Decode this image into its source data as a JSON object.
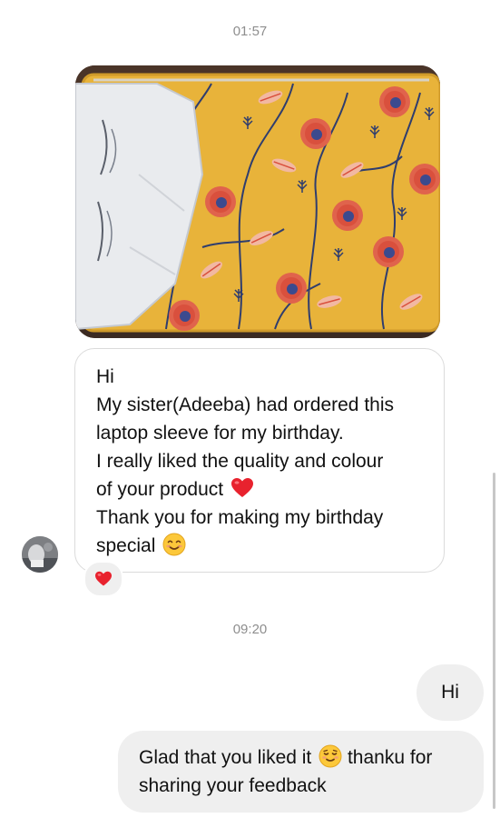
{
  "thread": {
    "timestamp_1": "01:57",
    "timestamp_2": "09:20"
  },
  "incoming_message": {
    "lines": [
      "Hi",
      "My sister(Adeeba) had ordered this",
      "laptop sleeve for my birthday.",
      "I really liked the quality and colour",
      "of your product",
      "Thank you for making my birthday",
      "special"
    ],
    "emojis": [
      "red-heart",
      "smiling-face"
    ],
    "reaction": "red-heart"
  },
  "outgoing_messages": [
    {
      "text": "Hi"
    },
    {
      "line_1_a": "Glad that you liked it",
      "line_1_b": "thanku for",
      "line_2": "sharing your feedback",
      "emoji": "relieved-smile"
    }
  ],
  "colors": {
    "incoming_border": "#dbdbdb",
    "outgoing_bg": "#efefef",
    "timestamp": "#8e8e8e",
    "heart": "#e0245e"
  }
}
